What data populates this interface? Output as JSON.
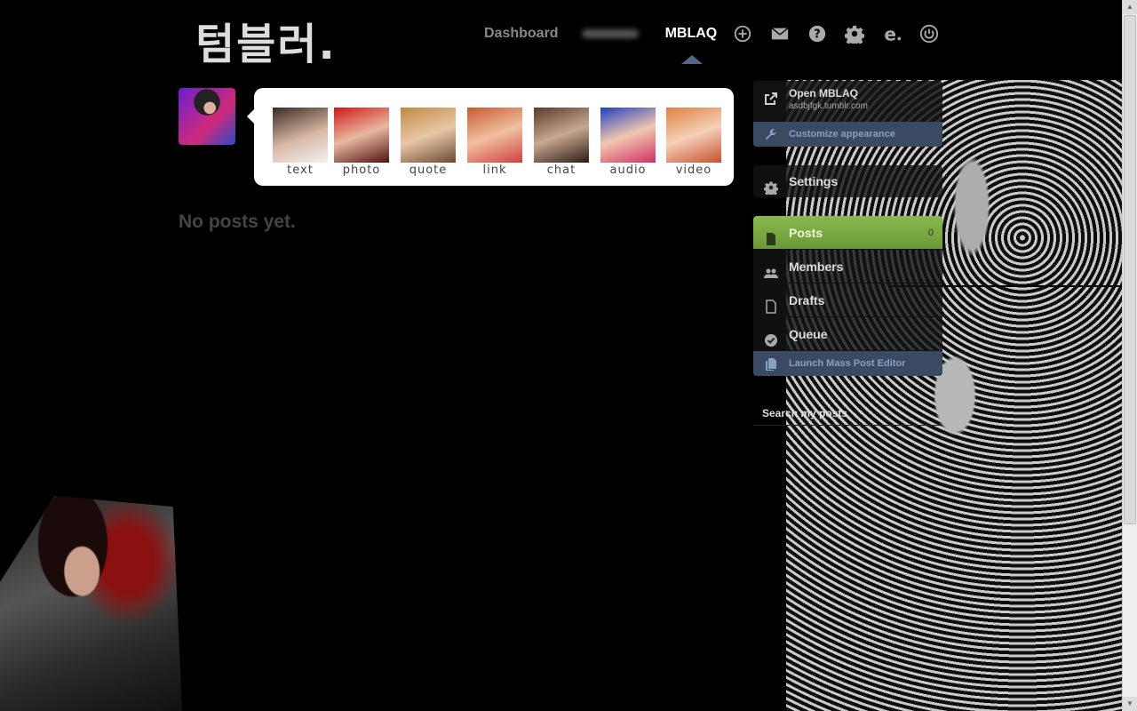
{
  "header": {
    "logo": "텀블러.",
    "nav": {
      "dashboard": "Dashboard",
      "blog_name": "MBLAQ"
    },
    "icons": [
      "plus-circle-icon",
      "mail-icon",
      "help-icon",
      "gear-icon",
      "e-icon",
      "power-icon"
    ]
  },
  "post_types": [
    {
      "label": "text"
    },
    {
      "label": "photo"
    },
    {
      "label": "quote"
    },
    {
      "label": "link"
    },
    {
      "label": "chat"
    },
    {
      "label": "audio"
    },
    {
      "label": "video"
    }
  ],
  "main": {
    "empty_message": "No posts yet."
  },
  "sidebar": {
    "open_blog": {
      "title": "Open MBLAQ",
      "url": "asdbjfgk.tumblr.com"
    },
    "customize": "Customize appearance",
    "settings": "Settings",
    "menu": [
      {
        "label": "Posts",
        "count": "0"
      },
      {
        "label": "Members"
      },
      {
        "label": "Drafts"
      },
      {
        "label": "Queue"
      }
    ],
    "mass_editor": "Launch Mass Post Editor",
    "search_placeholder": "Search my posts"
  },
  "colors": {
    "active_green": "#7aaa43",
    "blue_panel": "#3a4a63"
  }
}
